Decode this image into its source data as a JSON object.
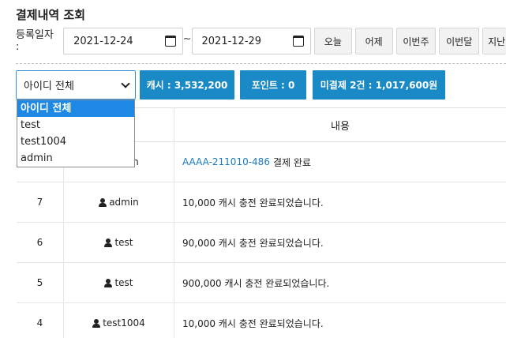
{
  "page_title": "결제내역 조회",
  "filter": {
    "label": "등록일자 :",
    "start_date": "2021-12-24",
    "separator": "~",
    "end_date": "2021-12-29",
    "quick_buttons": [
      "오늘",
      "어제",
      "이번주",
      "이번달",
      "지난"
    ]
  },
  "summary": {
    "select_value": "아이디 전체",
    "cash": "캐시 : 3,532,200",
    "point": "포인트 : 0",
    "unpaid": "미결제 2건 : 1,017,600원"
  },
  "dropdown": {
    "options": [
      "아이디 전체",
      "test",
      "test1004",
      "admin"
    ],
    "selected_index": 0
  },
  "table": {
    "header_content": "내용",
    "rows": [
      {
        "no": "",
        "user": "admin",
        "link": "AAAA-211010-486",
        "content": "결제 완료"
      },
      {
        "no": "7",
        "user": "admin",
        "link": "",
        "content": "10,000 캐시 충전 완료되었습니다."
      },
      {
        "no": "6",
        "user": "test",
        "link": "",
        "content": "90,000 캐시 충전 완료되었습니다."
      },
      {
        "no": "5",
        "user": "test",
        "link": "",
        "content": "900,000 캐시 충전 완료되었습니다."
      },
      {
        "no": "4",
        "user": "test1004",
        "link": "",
        "content": "10,000 캐시 충전 완료되었습니다."
      }
    ]
  },
  "colors": {
    "accent": "#1a8ac7",
    "selected": "#1e88e5",
    "link": "#1a7ac1"
  },
  "icons": {
    "calendar": "calendar-icon",
    "user": "user-icon",
    "chevron": "chevron-down-icon"
  }
}
